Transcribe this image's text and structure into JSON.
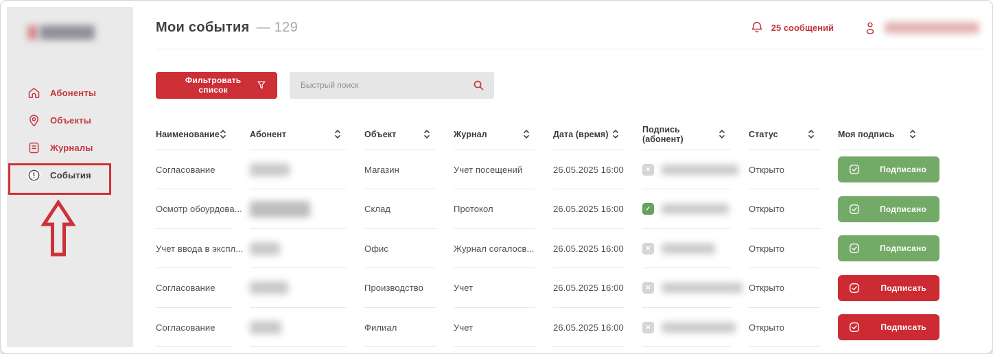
{
  "sidebar": {
    "items": [
      {
        "label": "Абоненты",
        "icon": "home-icon"
      },
      {
        "label": "Объекты",
        "icon": "location-pin-icon"
      },
      {
        "label": "Журналы",
        "icon": "journal-icon"
      },
      {
        "label": "События",
        "icon": "alert-circle-icon",
        "active": true,
        "annotated": true
      }
    ]
  },
  "header": {
    "title": "Мои события",
    "count": "— 129",
    "notifications_label": "25 сообщений"
  },
  "toolbar": {
    "filter_label": "Фильтровать список",
    "search_placeholder": "Быстрый поиск"
  },
  "table": {
    "columns": [
      "Наименование",
      "Абонент",
      "Объект",
      "Журнал",
      "Дата (время)",
      "Подпись (абонент)",
      "Статус",
      "Моя подпись"
    ],
    "rows": [
      {
        "name": "Согласование",
        "object": "Магазин",
        "journal": "Учет посещений",
        "datetime": "26.05.2025 16:00",
        "subscriber_signed": false,
        "status": "Открыто",
        "action_label": "Подписано",
        "action_signed": true
      },
      {
        "name": "Осмотр обоурдова...",
        "object": "Склад",
        "journal": "Протокол",
        "datetime": "26.05.2025 16:00",
        "subscriber_signed": true,
        "status": "Открыто",
        "action_label": "Подписано",
        "action_signed": true
      },
      {
        "name": "Учет ввода в экспл...",
        "object": "Офис",
        "journal": "Журнал согалосв...",
        "datetime": "26.05.2025 16:00",
        "subscriber_signed": false,
        "status": "Открыто",
        "action_label": "Подписано",
        "action_signed": true
      },
      {
        "name": "Согласование",
        "object": "Производство",
        "journal": "Учет",
        "datetime": "26.05.2025 16:00",
        "subscriber_signed": false,
        "status": "Открыто",
        "action_label": "Подписать",
        "action_signed": false
      },
      {
        "name": "Согласование",
        "object": "Филиал",
        "journal": "Учет",
        "datetime": "26.05.2025 16:00",
        "subscriber_signed": false,
        "status": "Открыто",
        "action_label": "Подписать",
        "action_signed": false
      }
    ]
  },
  "colors": {
    "accent_red": "#cc2f36",
    "signed_green": "#74aa67",
    "annotation_red": "#ce3137",
    "sidebar_bg": "#eaeaea"
  }
}
